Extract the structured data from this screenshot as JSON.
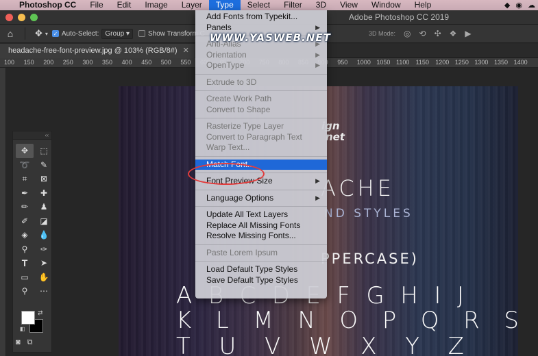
{
  "menubar": {
    "app_name": "Photoshop CC",
    "items": [
      "File",
      "Edit",
      "Image",
      "Layer",
      "Type",
      "Select",
      "Filter",
      "3D",
      "View",
      "Window",
      "Help"
    ],
    "active_item": "Type"
  },
  "window": {
    "title": "Adobe Photoshop CC 2019"
  },
  "options": {
    "auto_select_label": "Auto-Select:",
    "auto_select_value": "Group",
    "show_transform_label": "Show Transform C",
    "mode_3d_label": "3D Mode:"
  },
  "document": {
    "tab_title": "headache-free-font-preview.jpg @ 103% (RGB/8#)",
    "close_glyph": "✕"
  },
  "ruler": {
    "ticks": [
      "100",
      "150",
      "200",
      "250",
      "300",
      "350",
      "400",
      "450",
      "500",
      "550",
      "600",
      "650",
      "700",
      "750",
      "800",
      "850",
      "900",
      "950",
      "1000",
      "1050",
      "1100",
      "1150",
      "1200",
      "1250",
      "1300",
      "1350",
      "1400"
    ]
  },
  "type_menu": {
    "items": [
      {
        "label": "Add Fonts from Typekit...",
        "enabled": true,
        "submenu": false
      },
      {
        "label": "Panels",
        "enabled": true,
        "submenu": true
      },
      {
        "label": "Anti-Alias",
        "enabled": false,
        "submenu": true
      },
      {
        "label": "Orientation",
        "enabled": false,
        "submenu": true
      },
      {
        "label": "OpenType",
        "enabled": false,
        "submenu": true
      },
      {
        "label": "Extrude to 3D",
        "enabled": false,
        "submenu": false
      },
      {
        "label": "Create Work Path",
        "enabled": false,
        "submenu": false
      },
      {
        "label": "Convert to Shape",
        "enabled": false,
        "submenu": false
      },
      {
        "label": "Rasterize Type Layer",
        "enabled": false,
        "submenu": false
      },
      {
        "label": "Convert to Paragraph Text",
        "enabled": false,
        "submenu": false
      },
      {
        "label": "Warp Text...",
        "enabled": false,
        "submenu": false
      },
      {
        "label": "Match Font...",
        "enabled": true,
        "submenu": false,
        "highlighted": true
      },
      {
        "label": "Font Preview Size",
        "enabled": true,
        "submenu": true
      },
      {
        "label": "Language Options",
        "enabled": true,
        "submenu": true
      },
      {
        "label": "Update All Text Layers",
        "enabled": true,
        "submenu": false
      },
      {
        "label": "Replace All Missing Fonts",
        "enabled": true,
        "submenu": false
      },
      {
        "label": "Resolve Missing Fonts...",
        "enabled": true,
        "submenu": false
      },
      {
        "label": "Paste Lorem Ipsum",
        "enabled": false,
        "submenu": false
      },
      {
        "label": "Load Default Type Styles",
        "enabled": true,
        "submenu": false
      },
      {
        "label": "Save Default Type Styles",
        "enabled": true,
        "submenu": false
      }
    ]
  },
  "watermark": "WWW.YASWEB.NET",
  "artwork": {
    "logo_line1": "ign",
    "logo_line2": "net",
    "heading": "ACHE",
    "subheading": "ND STYLES",
    "uppercase_label": "PPERCASE)",
    "row1": [
      "A",
      "B",
      "C",
      "D",
      "E",
      "F",
      "G",
      "H",
      "I",
      "J"
    ],
    "row2": [
      "K",
      "L",
      "M",
      "N",
      "O",
      "P",
      "Q",
      "R",
      "S"
    ],
    "row3": [
      "T",
      "U",
      "V",
      "W",
      "X",
      "Y",
      "Z"
    ]
  },
  "colors": {
    "menu_highlight": "#1f68d8",
    "annotation_circle": "#e23c3c"
  }
}
